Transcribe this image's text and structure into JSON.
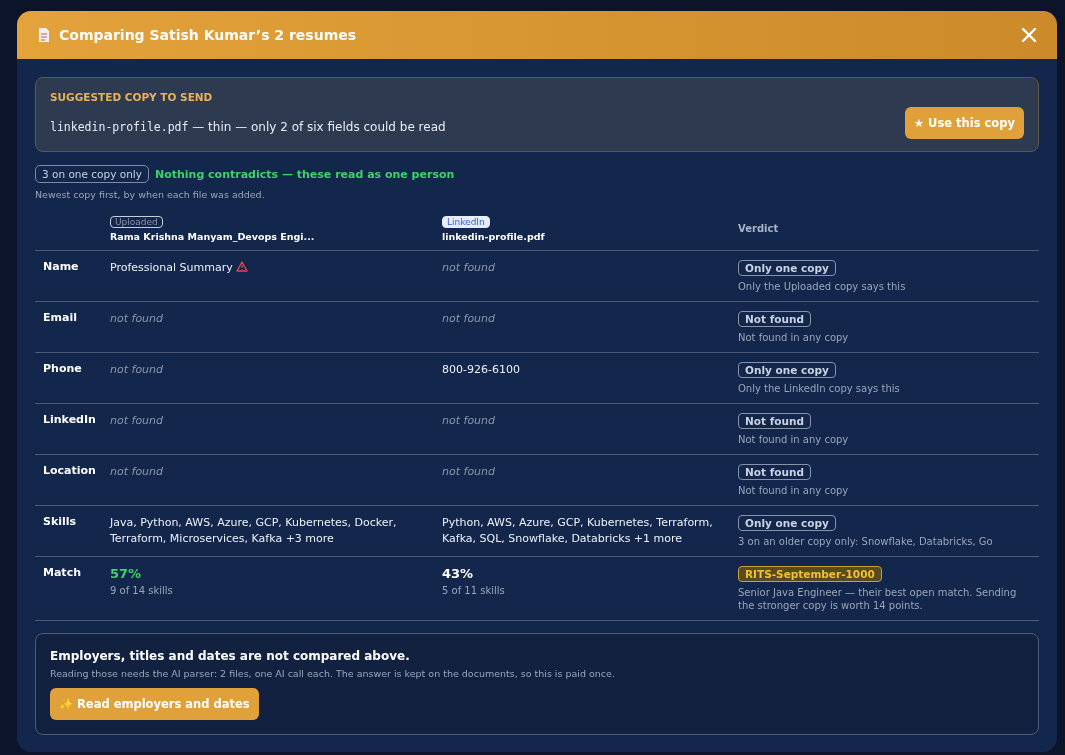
{
  "modal": {
    "title": "Comparing Satish Kumar’s 2 resumes"
  },
  "suggestion": {
    "heading": "SUGGESTED COPY TO SEND",
    "filename": "linkedin-profile.pdf",
    "note": " — thin — only 2 of six fields could be read",
    "button": "★ Use this copy"
  },
  "summary": {
    "badge": "3 on one copy only",
    "status": "Nothing contradicts — these read as one person",
    "note": "Newest copy first, by when each file was added."
  },
  "table": {
    "columns": [
      {
        "tag": "Uploaded",
        "kind": "uploaded",
        "file": "Rama Krishna Manyam_Devops Engi..."
      },
      {
        "tag": "LinkedIn",
        "kind": "linkedin",
        "file": "linkedin-profile.pdf"
      }
    ],
    "verdict_heading": "Verdict",
    "rows": [
      {
        "label": "Name",
        "cells": [
          {
            "kind": "value",
            "text": "Professional Summary",
            "flagged": true
          },
          {
            "kind": "missing",
            "text": "not found"
          }
        ],
        "verdict": {
          "badge": "Only one copy",
          "kind": "plain",
          "note": "Only the Uploaded copy says this"
        }
      },
      {
        "label": "Email",
        "cells": [
          {
            "kind": "missing",
            "text": "not found"
          },
          {
            "kind": "missing",
            "text": "not found"
          }
        ],
        "verdict": {
          "badge": "Not found",
          "kind": "plain",
          "note": "Not found in any copy"
        }
      },
      {
        "label": "Phone",
        "cells": [
          {
            "kind": "missing",
            "text": "not found"
          },
          {
            "kind": "value",
            "text": "800-926-6100",
            "flagged": false
          }
        ],
        "verdict": {
          "badge": "Only one copy",
          "kind": "plain",
          "note": "Only the LinkedIn copy says this"
        }
      },
      {
        "label": "LinkedIn",
        "cells": [
          {
            "kind": "missing",
            "text": "not found"
          },
          {
            "kind": "missing",
            "text": "not found"
          }
        ],
        "verdict": {
          "badge": "Not found",
          "kind": "plain",
          "note": "Not found in any copy"
        }
      },
      {
        "label": "Location",
        "cells": [
          {
            "kind": "missing",
            "text": "not found"
          },
          {
            "kind": "missing",
            "text": "not found"
          }
        ],
        "verdict": {
          "badge": "Not found",
          "kind": "plain",
          "note": "Not found in any copy"
        }
      },
      {
        "label": "Skills",
        "cells": [
          {
            "kind": "value",
            "text": "Java, Python, AWS, Azure, GCP, Kubernetes, Docker, Terraform, Microservices, Kafka +3 more",
            "flagged": false
          },
          {
            "kind": "value",
            "text": "Python, AWS, Azure, GCP, Kubernetes, Terraform, Kafka, SQL, Snowflake, Databricks +1 more",
            "flagged": false
          }
        ],
        "verdict": {
          "badge": "Only one copy",
          "kind": "plain",
          "note": "3 on an older copy only: Snowflake, Databricks, Go"
        }
      },
      {
        "label": "Match",
        "cells": [
          {
            "kind": "match",
            "text": "57%",
            "sub": "9 of 14 skills",
            "best": true
          },
          {
            "kind": "match",
            "text": "43%",
            "sub": "5 of 11 skills",
            "best": false
          }
        ],
        "verdict": {
          "badge": "RITS-September-1000",
          "kind": "job",
          "note": "Senior Java Engineer — their best open match. Sending the stronger copy is worth 14 points."
        }
      }
    ]
  },
  "footer": {
    "title": "Employers, titles and dates are not compared above.",
    "text": "Reading those needs the AI parser: 2 files, one AI call each. The answer is kept on the documents, so this is paid once.",
    "button": "✨ Read employers and dates"
  }
}
